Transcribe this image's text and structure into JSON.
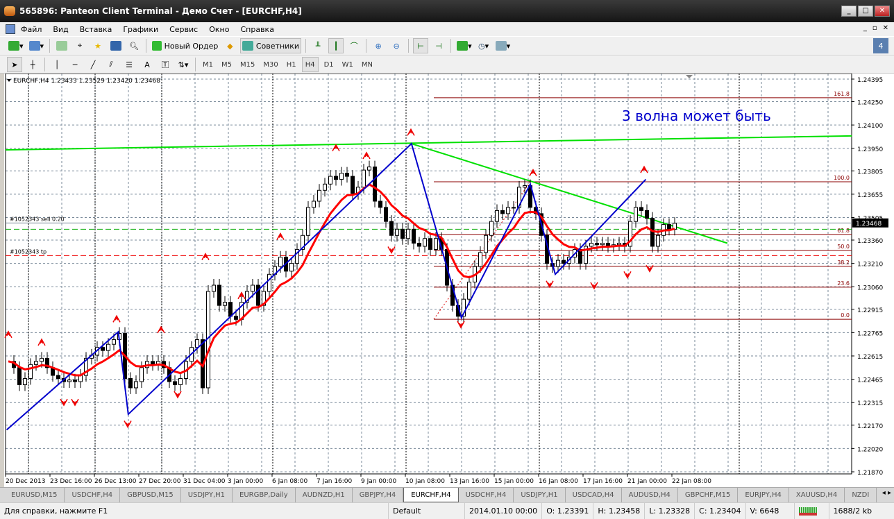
{
  "window": {
    "title": "565896: Panteon Client Terminal - Демо Счет - [EURCHF,H4]"
  },
  "menu": [
    "Файл",
    "Вид",
    "Вставка",
    "Графики",
    "Сервис",
    "Окно",
    "Справка"
  ],
  "toolbar": {
    "new_order": "Новый Ордер",
    "experts": "Советники"
  },
  "drawing_tools": {
    "text_tool": "A"
  },
  "timeframes": [
    "M1",
    "M5",
    "M15",
    "M30",
    "H1",
    "H4",
    "D1",
    "W1",
    "MN"
  ],
  "active_timeframe": "H4",
  "tabs": [
    "EURUSD,M15",
    "USDCHF,H4",
    "GBPUSD,M15",
    "USDJPY,H1",
    "EURGBP,Daily",
    "AUDNZD,H1",
    "GBPJPY,H4",
    "EURCHF,H4",
    "USDCHF,H4",
    "USDJPY,H1",
    "USDCAD,H4",
    "AUDUSD,H4",
    "GBPCHF,M15",
    "EURJPY,H4",
    "XAUUSD,H4",
    "NZDI"
  ],
  "active_tab": "EURCHF,H4",
  "status": {
    "help": "Для справки, нажмите F1",
    "profile": "Default",
    "time": "2014.01.10 00:00",
    "open": "O: 1.23391",
    "high": "H: 1.23458",
    "low": "L: 1.23328",
    "close": "C: 1.23404",
    "volume": "V: 6648",
    "traffic": "1688/2 kb"
  },
  "chart_data": {
    "type": "candlestick",
    "header": "EURCHF,H4  1.23433 1.23529 1.23420 1.23468",
    "current_price": "1.23468",
    "annotation": "3 волна может быть",
    "y_ticks": [
      "1.24395",
      "1.24250",
      "1.24100",
      "1.23950",
      "1.23805",
      "1.23655",
      "1.23505",
      "1.23360",
      "1.23210",
      "1.23060",
      "1.22915",
      "1.22765",
      "1.22615",
      "1.22465",
      "1.22315",
      "1.22170",
      "1.22020",
      "1.21870"
    ],
    "ylim": [
      1.2187,
      1.24395
    ],
    "x_ticks": [
      "20 Dec 2013",
      "23 Dec 16:00",
      "26 Dec 13:00",
      "27 Dec 20:00",
      "31 Dec 04:00",
      "3 Jan 00:00",
      "6 Jan 08:00",
      "7 Jan 16:00",
      "9 Jan 00:00",
      "10 Jan 08:00",
      "13 Jan 16:00",
      "15 Jan 00:00",
      "16 Jan 08:00",
      "17 Jan 16:00",
      "21 Jan 00:00",
      "22 Jan 08:00"
    ],
    "closes": [
      1.2258,
      1.2254,
      1.2243,
      1.2247,
      1.2256,
      1.2258,
      1.226,
      1.2254,
      1.2249,
      1.2247,
      1.2245,
      1.2246,
      1.2245,
      1.2249,
      1.226,
      1.2262,
      1.2267,
      1.2265,
      1.2269,
      1.2272,
      1.2276,
      1.2247,
      1.2241,
      1.2245,
      1.2254,
      1.2258,
      1.2256,
      1.2258,
      1.2254,
      1.2245,
      1.2243,
      1.2247,
      1.2258,
      1.2267,
      1.2272,
      1.2241,
      1.2303,
      1.2307,
      1.2294,
      1.2296,
      1.2287,
      1.2285,
      1.2296,
      1.2303,
      1.2307,
      1.2294,
      1.2303,
      1.2314,
      1.2319,
      1.2325,
      1.2316,
      1.2321,
      1.233,
      1.2339,
      1.2357,
      1.2361,
      1.2368,
      1.2372,
      1.2377,
      1.2375,
      1.2379,
      1.2377,
      1.2366,
      1.237,
      1.2381,
      1.2383,
      1.2361,
      1.2357,
      1.2348,
      1.2339,
      1.2343,
      1.2337,
      1.2343,
      1.2334,
      1.2332,
      1.2337,
      1.233,
      1.2337,
      1.233,
      1.2307,
      1.2294,
      1.2287,
      1.2298,
      1.2309,
      1.2319,
      1.2328,
      1.2339,
      1.2348,
      1.2355,
      1.2353,
      1.2357,
      1.2357,
      1.237,
      1.2371,
      1.2357,
      1.2353,
      1.2339,
      1.2321,
      1.2319,
      1.2323,
      1.2321,
      1.2325,
      1.233,
      1.2321,
      1.2332,
      1.2334,
      1.2333,
      1.2334,
      1.2332,
      1.2333,
      1.2334,
      1.2332,
      1.2348,
      1.2357,
      1.2355,
      1.235,
      1.2332,
      1.2339,
      1.2346,
      1.2343,
      1.23468
    ],
    "zigzag": [
      {
        "bar": -0.3,
        "price": 1.2214
      },
      {
        "bar": 19.8,
        "price": 1.2277
      },
      {
        "bar": 21.6,
        "price": 1.2224
      },
      {
        "bar": 72.6,
        "price": 1.2398
      },
      {
        "bar": 81.6,
        "price": 1.2286
      },
      {
        "bar": 94,
        "price": 1.2372
      },
      {
        "bar": 98.5,
        "price": 1.2314
      },
      {
        "bar": 114.8,
        "price": 1.2375
      }
    ],
    "trendline_upper": {
      "from": {
        "bar": -0.5,
        "price": 1.2394
      },
      "to": {
        "bar": 151.9,
        "price": 1.2403
      }
    },
    "trendline_lower": {
      "from": {
        "bar": 72.6,
        "price": 1.2398
      },
      "to": {
        "bar": 129.5,
        "price": 1.2334
      }
    },
    "fibo": [
      {
        "label": "161.8",
        "price": 1.24275
      },
      {
        "label": "100.0",
        "price": 1.23735
      },
      {
        "label": "61.8",
        "price": 1.23396
      },
      {
        "label": "50.0",
        "price": 1.23293
      },
      {
        "label": "38.2",
        "price": 1.23191
      },
      {
        "label": "23.6",
        "price": 1.23057
      },
      {
        "label": "0.0",
        "price": 1.22851
      }
    ],
    "orders": [
      {
        "label": "#1052343 sell 0.20",
        "price": 1.2347,
        "kind": "sell"
      },
      {
        "label": "",
        "price": 1.2343,
        "kind": "sl"
      },
      {
        "label": "#1052343 tp",
        "price": 1.2326,
        "kind": "tp"
      }
    ],
    "fractals": [
      {
        "bar": 0,
        "price": 1.2275,
        "dir": "up"
      },
      {
        "bar": 6,
        "price": 1.227,
        "dir": "up"
      },
      {
        "bar": 10,
        "price": 1.2232,
        "dir": "down"
      },
      {
        "bar": 12,
        "price": 1.2232,
        "dir": "down"
      },
      {
        "bar": 19.5,
        "price": 1.2285,
        "dir": "up"
      },
      {
        "bar": 21.5,
        "price": 1.2218,
        "dir": "down"
      },
      {
        "bar": 27.5,
        "price": 1.2278,
        "dir": "up"
      },
      {
        "bar": 30.5,
        "price": 1.2237,
        "dir": "down"
      },
      {
        "bar": 35.5,
        "price": 1.2325,
        "dir": "up"
      },
      {
        "bar": 42,
        "price": 1.23,
        "dir": "up"
      },
      {
        "bar": 49,
        "price": 1.2338,
        "dir": "up"
      },
      {
        "bar": 59,
        "price": 1.2395,
        "dir": "up"
      },
      {
        "bar": 64.5,
        "price": 1.239,
        "dir": "up"
      },
      {
        "bar": 72.5,
        "price": 1.2405,
        "dir": "up"
      },
      {
        "bar": 69,
        "price": 1.233,
        "dir": "down"
      },
      {
        "bar": 81.5,
        "price": 1.2282,
        "dir": "down"
      },
      {
        "bar": 94.5,
        "price": 1.2379,
        "dir": "up"
      },
      {
        "bar": 97.5,
        "price": 1.2308,
        "dir": "down"
      },
      {
        "bar": 105.5,
        "price": 1.2307,
        "dir": "down"
      },
      {
        "bar": 111.5,
        "price": 1.2314,
        "dir": "down"
      },
      {
        "bar": 114.5,
        "price": 1.2381,
        "dir": "up"
      },
      {
        "bar": 115.5,
        "price": 1.2318,
        "dir": "down"
      }
    ],
    "ma_color": "#ff0000",
    "zigzag_color": "#0000cc",
    "fibo_color": "#8b0000",
    "grid": true
  }
}
